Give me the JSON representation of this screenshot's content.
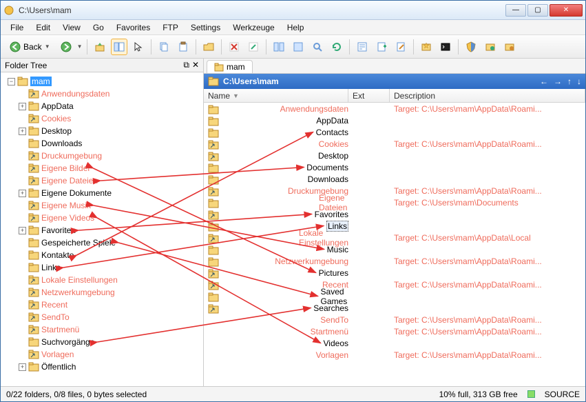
{
  "window": {
    "title": "C:\\Users\\mam"
  },
  "menu": [
    "File",
    "Edit",
    "View",
    "Go",
    "Favorites",
    "FTP",
    "Settings",
    "Werkzeuge",
    "Help"
  ],
  "back_label": "Back",
  "tree_header": "Folder Tree",
  "tree": {
    "root_label": "mam",
    "items": [
      {
        "label": "Anwendungsdaten",
        "junction": true
      },
      {
        "label": "AppData",
        "junction": false,
        "expander": "+"
      },
      {
        "label": "Cookies",
        "junction": true
      },
      {
        "label": "Desktop",
        "junction": false,
        "expander": "+"
      },
      {
        "label": "Downloads",
        "junction": false
      },
      {
        "label": "Druckumgebung",
        "junction": true
      },
      {
        "label": "Eigene Bilder",
        "junction": true
      },
      {
        "label": "Eigene Dateien",
        "junction": true
      },
      {
        "label": "Eigene Dokumente",
        "junction": false,
        "expander": "+"
      },
      {
        "label": "Eigene Musik",
        "junction": true
      },
      {
        "label": "Eigene Videos",
        "junction": true
      },
      {
        "label": "Favoriten",
        "junction": false,
        "expander": "+"
      },
      {
        "label": "Gespeicherte Spiele",
        "junction": false
      },
      {
        "label": "Kontakte",
        "junction": false
      },
      {
        "label": "Links",
        "junction": false
      },
      {
        "label": "Lokale Einstellungen",
        "junction": true
      },
      {
        "label": "Netzwerkumgebung",
        "junction": true
      },
      {
        "label": "Recent",
        "junction": true
      },
      {
        "label": "SendTo",
        "junction": true
      },
      {
        "label": "Startmenü",
        "junction": true
      },
      {
        "label": "Suchvorgänge",
        "junction": false
      },
      {
        "label": "Vorlagen",
        "junction": true
      },
      {
        "label": "Öffentlich",
        "junction": false,
        "expander": "+"
      }
    ]
  },
  "tab_label": "mam",
  "path": "C:\\Users\\mam",
  "columns": {
    "name": "Name",
    "ext": "Ext",
    "desc": "Description"
  },
  "files": [
    {
      "name": "Anwendungsdaten",
      "junction": true,
      "desc": "Target: C:\\Users\\mam\\AppData\\Roami..."
    },
    {
      "name": "AppData",
      "junction": false,
      "desc": ""
    },
    {
      "name": "Contacts",
      "junction": false,
      "desc": ""
    },
    {
      "name": "Cookies",
      "junction": true,
      "desc": "Target: C:\\Users\\mam\\AppData\\Roami..."
    },
    {
      "name": "Desktop",
      "junction": false,
      "desc": ""
    },
    {
      "name": "Documents",
      "junction": false,
      "desc": ""
    },
    {
      "name": "Downloads",
      "junction": false,
      "desc": ""
    },
    {
      "name": "Druckumgebung",
      "junction": true,
      "desc": "Target: C:\\Users\\mam\\AppData\\Roami..."
    },
    {
      "name": "Eigene Dateien",
      "junction": true,
      "desc": "Target: C:\\Users\\mam\\Documents"
    },
    {
      "name": "Favorites",
      "junction": false,
      "desc": ""
    },
    {
      "name": "Links",
      "junction": false,
      "desc": "",
      "selected": true
    },
    {
      "name": "Lokale Einstellungen",
      "junction": true,
      "desc": "Target: C:\\Users\\mam\\AppData\\Local"
    },
    {
      "name": "Music",
      "junction": false,
      "desc": ""
    },
    {
      "name": "Netzwerkumgebung",
      "junction": true,
      "desc": "Target: C:\\Users\\mam\\AppData\\Roami..."
    },
    {
      "name": "Pictures",
      "junction": false,
      "desc": ""
    },
    {
      "name": "Recent",
      "junction": true,
      "desc": "Target: C:\\Users\\mam\\AppData\\Roami..."
    },
    {
      "name": "Saved Games",
      "junction": false,
      "desc": ""
    },
    {
      "name": "Searches",
      "junction": false,
      "desc": ""
    },
    {
      "name": "SendTo",
      "junction": true,
      "desc": "Target: C:\\Users\\mam\\AppData\\Roami..."
    },
    {
      "name": "Startmenü",
      "junction": true,
      "desc": "Target: C:\\Users\\mam\\AppData\\Roami..."
    },
    {
      "name": "Videos",
      "junction": false,
      "desc": ""
    },
    {
      "name": "Vorlagen",
      "junction": true,
      "desc": "Target: C:\\Users\\mam\\AppData\\Roami..."
    }
  ],
  "status": {
    "left": "0/22 folders, 0/8 files, 0 bytes selected",
    "disk": "10% full, 313 GB free",
    "source": "SOURCE"
  },
  "arrows": [
    {
      "from": 6,
      "to": 14
    },
    {
      "from": 7,
      "to": 5
    },
    {
      "from": 9,
      "to": 12
    },
    {
      "from": 10,
      "to": 20
    },
    {
      "from": 11,
      "to": 9
    },
    {
      "from": 12,
      "to": 16
    },
    {
      "from": 13,
      "to": 2
    },
    {
      "from": 14,
      "to": 10
    },
    {
      "from": 20,
      "to": 17
    }
  ]
}
